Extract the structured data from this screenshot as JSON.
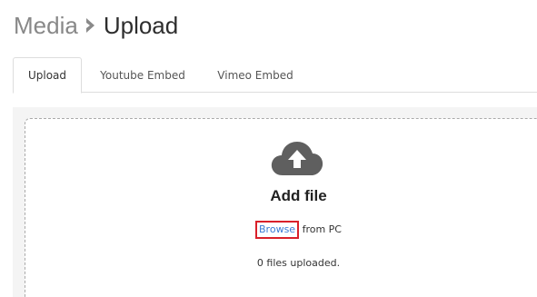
{
  "header": {
    "parent": "Media",
    "current": "Upload"
  },
  "tabs": [
    {
      "label": "Upload",
      "active": true
    },
    {
      "label": "Youtube Embed",
      "active": false
    },
    {
      "label": "Vimeo Embed",
      "active": false
    }
  ],
  "dropzone": {
    "icon": "cloud-upload-icon",
    "title": "Add file",
    "browse_label": "Browse",
    "browse_suffix": " from PC",
    "status": "0 files uploaded."
  },
  "colors": {
    "icon_gray": "#5f5f5f",
    "highlight_red": "#d9202a",
    "panel_bg": "#f4f4f4"
  }
}
